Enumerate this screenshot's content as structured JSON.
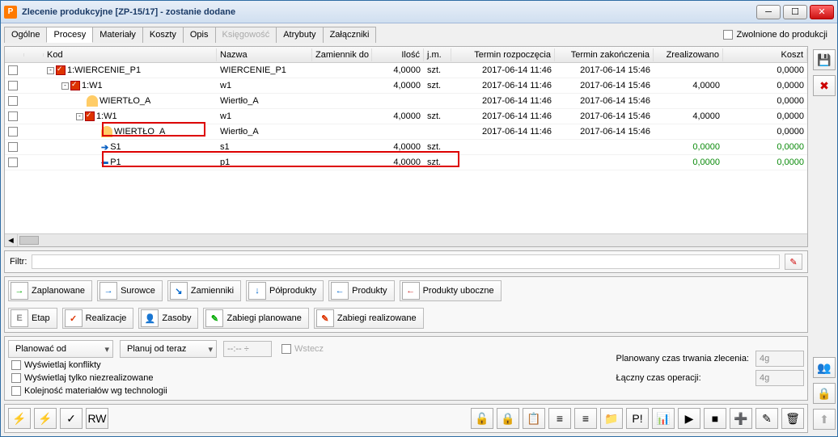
{
  "window": {
    "title": "Zlecenie produkcyjne  [ZP-15/17] - zostanie dodane",
    "app_badge": "P"
  },
  "tabs": {
    "items": [
      "Ogólne",
      "Procesy",
      "Materiały",
      "Koszty",
      "Opis",
      "Księgowość",
      "Atrybuty",
      "Załączniki"
    ],
    "active": 1,
    "disabled": 5
  },
  "released_label": "Zwolnione do produkcji",
  "columns": {
    "kod": "Kod",
    "nazwa": "Nazwa",
    "zamiennik": "Zamiennik do",
    "ilosc": "Ilość",
    "jm": "j.m.",
    "rozp": "Termin rozpoczęcia",
    "zak": "Termin zakończenia",
    "zreal": "Zrealizowano",
    "koszt": "Koszt"
  },
  "rows": [
    {
      "indent": 0,
      "exp": "-",
      "ico": "chk",
      "kod": "1:WIERCENIE_P1",
      "nazwa": "WIERCENIE_P1",
      "ilosc": "4,0000",
      "jm": "szt.",
      "rozp": "2017-06-14 11:46",
      "zak": "2017-06-14 15:46",
      "zreal": "",
      "koszt": "0,0000"
    },
    {
      "indent": 1,
      "exp": "-",
      "ico": "chk",
      "kod": "1:W1",
      "nazwa": "w1",
      "ilosc": "4,0000",
      "jm": "szt.",
      "rozp": "2017-06-14 11:46",
      "zak": "2017-06-14 15:46",
      "zreal": "4,0000",
      "koszt": "0,0000"
    },
    {
      "indent": 2,
      "exp": "",
      "ico": "person",
      "kod": "WIERTŁO_A",
      "nazwa": "Wiertło_A",
      "ilosc": "",
      "jm": "",
      "rozp": "2017-06-14 11:46",
      "zak": "2017-06-14 15:46",
      "zreal": "",
      "koszt": "0,0000"
    },
    {
      "indent": 2,
      "exp": "-",
      "ico": "chk",
      "kod": "1:W1",
      "nazwa": "w1",
      "ilosc": "4,0000",
      "jm": "szt.",
      "rozp": "2017-06-14 11:46",
      "zak": "2017-06-14 15:46",
      "zreal": "4,0000",
      "koszt": "0,0000"
    },
    {
      "indent": 3,
      "exp": "",
      "ico": "person",
      "kod": "WIERTŁO_A",
      "nazwa": "Wiertło_A",
      "ilosc": "",
      "jm": "",
      "rozp": "2017-06-14 11:46",
      "zak": "2017-06-14 15:46",
      "zreal": "",
      "koszt": "0,0000"
    },
    {
      "indent": 3,
      "exp": "",
      "ico": "arrow-r",
      "kod": "S1",
      "nazwa": "s1",
      "ilosc": "4,0000",
      "jm": "szt.",
      "rozp": "",
      "zak": "",
      "zreal": "0,0000",
      "zreal_green": true,
      "koszt": "0,0000",
      "koszt_green": true
    },
    {
      "indent": 3,
      "exp": "",
      "ico": "arrow-l",
      "kod": "P1",
      "nazwa": "p1",
      "ilosc": "4,0000",
      "jm": "szt.",
      "rozp": "",
      "zak": "",
      "zreal": "0,0000",
      "zreal_green": true,
      "koszt": "0,0000",
      "koszt_green": true
    }
  ],
  "filter_label": "Filtr:",
  "toolbar1": [
    {
      "ico": "→",
      "color": "#0a0",
      "label": "Zaplanowane"
    },
    {
      "ico": "→",
      "color": "#06c",
      "label": "Surowce"
    },
    {
      "ico": "↘",
      "color": "#06c",
      "label": "Zamienniki"
    },
    {
      "ico": "↓",
      "color": "#06c",
      "label": "Półprodukty"
    },
    {
      "ico": "←",
      "color": "#06c",
      "label": "Produkty"
    },
    {
      "ico": "←",
      "color": "#c33",
      "label": "Produkty uboczne"
    }
  ],
  "toolbar2": [
    {
      "ico": "E",
      "color": "#888",
      "label": "Etap"
    },
    {
      "ico": "✓",
      "color": "#d30",
      "label": "Realizacje"
    },
    {
      "ico": "👤",
      "color": "#c80",
      "label": "Zasoby"
    },
    {
      "ico": "✎",
      "color": "#0a0",
      "label": "Zabiegi planowane"
    },
    {
      "ico": "✎",
      "color": "#d30",
      "label": "Zabiegi realizowane"
    }
  ],
  "plan": {
    "planowac_od": "Planować od",
    "planuj_od_teraz": "Planuj od teraz",
    "time_placeholder": "--:-- ÷",
    "wstecz": "Wstecz",
    "konflikty": "Wyświetlaj konflikty",
    "niezreal": "Wyświetlaj tylko niezrealizowane",
    "kolejnosc": "Kolejność materiałów wg technologii",
    "plan_czas_label": "Planowany czas trwania zlecenia:",
    "laczny_label": "Łączny czas operacji:",
    "plan_czas_val": "4g",
    "laczny_val": "4g"
  },
  "bottom_icons": [
    "⚡",
    "⚡",
    "✓",
    "RW"
  ],
  "bottom_icons_right": [
    "🔓",
    "🔒",
    "📋",
    "≡",
    "≡",
    "📁",
    "P!",
    "📊",
    "▶",
    "■",
    "➕",
    "✎",
    "🗑"
  ]
}
